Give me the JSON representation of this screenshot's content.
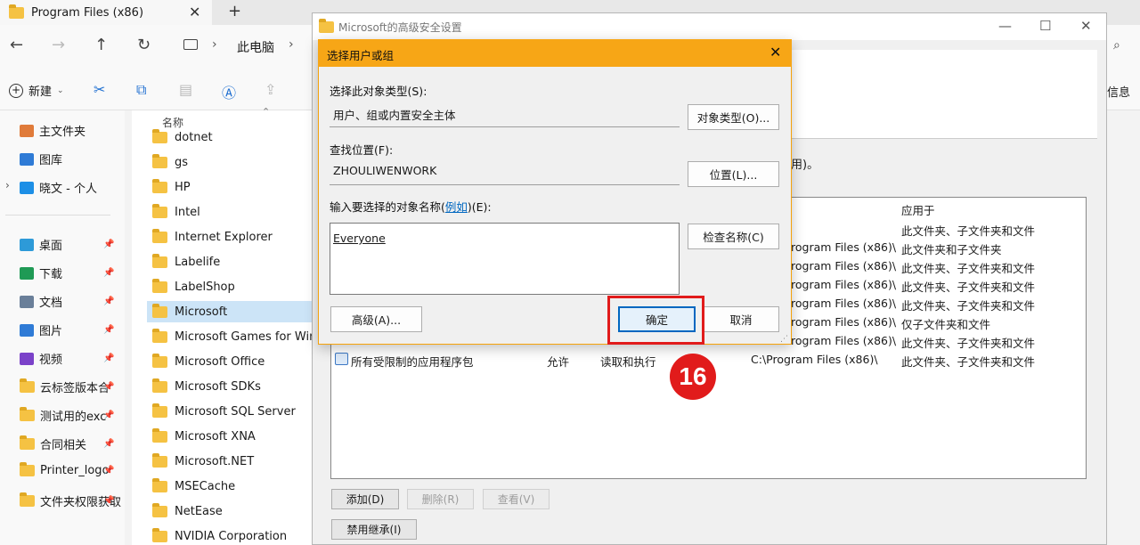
{
  "explorer": {
    "tab_title": "Program Files (x86)",
    "tab_close": "✕",
    "tab_add": "+",
    "breadcrumb": [
      "此电脑"
    ],
    "toolbar_new": "新建",
    "toolbar_right": "信息"
  },
  "nav": {
    "items": [
      {
        "label": "主文件夹",
        "icon": "home-icon",
        "color": "#e07b3a"
      },
      {
        "label": "图库",
        "icon": "gallery-icon",
        "color": "#2f7bd6"
      },
      {
        "label": "晓文 - 个人",
        "icon": "cloud-icon",
        "color": "#1d8fe6"
      },
      {
        "label": "桌面",
        "icon": "desktop-icon",
        "color": "#2d9ad8"
      },
      {
        "label": "下载",
        "icon": "download-icon",
        "color": "#1f9a55"
      },
      {
        "label": "文档",
        "icon": "document-icon",
        "color": "#6a7f99"
      },
      {
        "label": "图片",
        "icon": "pictures-icon",
        "color": "#2f7bd6"
      },
      {
        "label": "视频",
        "icon": "videos-icon",
        "color": "#7b42c9"
      },
      {
        "label": "云标签版本合",
        "icon": "folder-icon",
        "color": "#f5c243"
      },
      {
        "label": "测试用的exc",
        "icon": "folder-icon",
        "color": "#f5c243"
      },
      {
        "label": "合同相关",
        "icon": "folder-icon",
        "color": "#f5c243"
      },
      {
        "label": "Printer_logo",
        "icon": "folder-icon",
        "color": "#f5c243"
      },
      {
        "label": "文件夹权限获取",
        "icon": "folder-icon",
        "color": "#f5c243"
      }
    ]
  },
  "filelist": {
    "column_name": "名称",
    "rows": [
      "dotnet",
      "gs",
      "HP",
      "Intel",
      "Internet Explorer",
      "Labelife",
      "LabelShop",
      "Microsoft",
      "Microsoft Games for Windows",
      "Microsoft Office",
      "Microsoft SDKs",
      "Microsoft SQL Server",
      "Microsoft XNA",
      "Microsoft.NET",
      "MSECache",
      "NetEase",
      "NVIDIA Corporation"
    ],
    "selected": "Microsoft"
  },
  "security": {
    "title": "Microsoft的高级安全设置",
    "note_tail": "用)。",
    "col_applies": "应用于",
    "rows": [
      {
        "path": "",
        "applies": "此文件夹、子文件夹和文件"
      },
      {
        "path": "rogram Files (x86)\\",
        "applies": "此文件夹和子文件夹"
      },
      {
        "path": "rogram Files (x86)\\",
        "applies": "此文件夹、子文件夹和文件"
      },
      {
        "path": "rogram Files (x86)\\",
        "applies": "此文件夹、子文件夹和文件"
      },
      {
        "path": "rogram Files (x86)\\",
        "applies": "此文件夹、子文件夹和文件"
      },
      {
        "path": "rogram Files (x86)\\",
        "applies": "仅子文件夹和文件"
      },
      {
        "path": "rogram Files (x86)\\",
        "applies": "此文件夹、子文件夹和文件"
      }
    ],
    "last_row": {
      "principal": "所有受限制的应用程序包",
      "type": "允许",
      "access": "读取和执行",
      "path": "C:\\Program Files (x86)\\",
      "applies": "此文件夹、子文件夹和文件"
    },
    "btn_add": "添加(D)",
    "btn_remove": "删除(R)",
    "btn_view": "查看(V)",
    "btn_disable_inherit": "禁用继承(I)"
  },
  "dialog": {
    "title": "选择用户或组",
    "close": "✕",
    "object_type_label": "选择此对象类型(S):",
    "object_type_value": "用户、组或内置安全主体",
    "object_type_button": "对象类型(O)...",
    "location_label": "查找位置(F):",
    "location_value": "ZHOULIWENWORK",
    "location_button": "位置(L)...",
    "names_label_prefix": "输入要选择的对象名称(",
    "names_label_link": "例如",
    "names_label_suffix": ")(E):",
    "names_value": "Everyone",
    "check_names_button": "检查名称(C)",
    "advanced_button": "高级(A)...",
    "ok_button": "确定",
    "cancel_button": "取消"
  },
  "annotation": {
    "step_number": "16",
    "color": "#e11b1b"
  }
}
